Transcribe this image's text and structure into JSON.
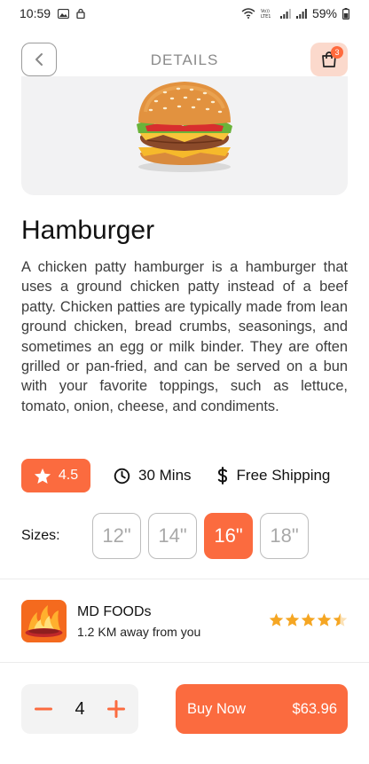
{
  "status_bar": {
    "time": "10:59",
    "battery": "59%"
  },
  "header": {
    "title": "DETAILS",
    "cart_count": "3"
  },
  "product": {
    "name": "Hamburger",
    "description": "A chicken patty hamburger is a hamburger that uses a ground chicken patty instead of a beef patty. Chicken patties are typically made from lean ground chicken, bread crumbs, seasonings, and sometimes an egg or milk binder. They are often grilled or pan-fried, and can be served on a bun with your favorite toppings, such as lettuce, tomato, onion, cheese, and condiments.",
    "rating": "4.5",
    "time": "30 Mins",
    "shipping": "Free Shipping"
  },
  "sizes": {
    "label": "Sizes:",
    "options": [
      "12\"",
      "14\"",
      "16\"",
      "18\""
    ],
    "selected": "16\""
  },
  "restaurant": {
    "name": "MD FOODs",
    "distance": "1.2 KM away from you",
    "stars": 4.5
  },
  "order": {
    "quantity": "4",
    "buy_label": "Buy Now",
    "price": "$63.96"
  },
  "colors": {
    "accent": "#fb6b3f",
    "accent_light": "#fbd9cc",
    "star": "#f5a623"
  }
}
